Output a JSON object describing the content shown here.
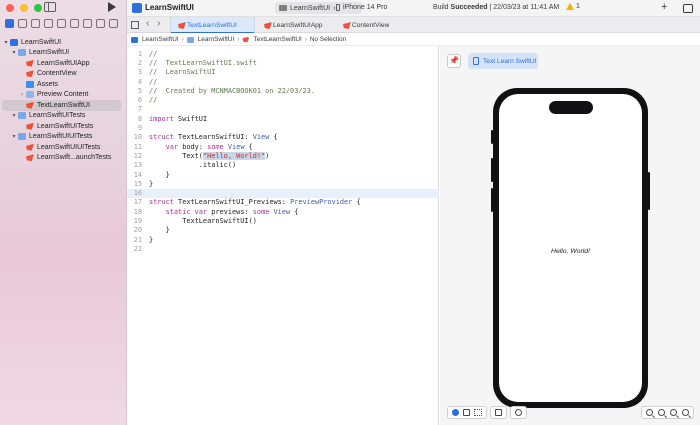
{
  "sidebar": {
    "tree": [
      {
        "label": "LearnSwiftUI",
        "kind": "project",
        "chevron": "▾",
        "indent": 0
      },
      {
        "label": "LearnSwiftUI",
        "kind": "folder",
        "chevron": "▾",
        "indent": 1
      },
      {
        "label": "LearnSwiftUIApp",
        "kind": "swift",
        "chevron": "",
        "indent": 2
      },
      {
        "label": "ContentView",
        "kind": "swift",
        "chevron": "",
        "indent": 2
      },
      {
        "label": "Assets",
        "kind": "assets",
        "chevron": "",
        "indent": 2
      },
      {
        "label": "Preview Content",
        "kind": "preview",
        "chevron": "›",
        "indent": 2
      },
      {
        "label": "TextLearnSwiftUI",
        "kind": "swift",
        "chevron": "",
        "indent": 2,
        "selected": true
      },
      {
        "label": "LearnSwiftUITests",
        "kind": "folder",
        "chevron": "▾",
        "indent": 1
      },
      {
        "label": "LearnSwiftUITests",
        "kind": "swift",
        "chevron": "",
        "indent": 2
      },
      {
        "label": "LearnSwiftUIUITests",
        "kind": "folder",
        "chevron": "▾",
        "indent": 1
      },
      {
        "label": "LearnSwiftUIUITests",
        "kind": "swift",
        "chevron": "",
        "indent": 2
      },
      {
        "label": "LearnSwift...aunchTests",
        "kind": "swift",
        "chevron": "",
        "indent": 2
      }
    ]
  },
  "toolbar": {
    "app_title": "LearnSwiftUI",
    "scheme": "LearnSwiftUI",
    "destination": "iPhone 14 Pro",
    "status_prefix": "Build",
    "status_bold": "Succeeded",
    "status_suffix": "| 22/03/23 at 11:41 AM",
    "warning_count": "1",
    "plus": "+"
  },
  "tabs": [
    {
      "label": "TextLearnSwiftUI",
      "active": true
    },
    {
      "label": "LearnSwiftUIApp",
      "active": false
    },
    {
      "label": "ContentView",
      "active": false
    }
  ],
  "nav": {
    "back": "‹",
    "forward": "›"
  },
  "breadcrumb": [
    "LearnSwiftUI",
    "LearnSwiftUI",
    "TextLearnSwiftUI",
    "No Selection"
  ],
  "code": {
    "current_line": 16,
    "lines": [
      [
        {
          "t": "//",
          "c": "comment"
        }
      ],
      [
        {
          "t": "//  TextLearnSwiftUI.swift",
          "c": "comment"
        }
      ],
      [
        {
          "t": "//  LearnSwiftUI",
          "c": "comment"
        }
      ],
      [
        {
          "t": "//",
          "c": "comment"
        }
      ],
      [
        {
          "t": "//  Created by MCNMACBOOK01 on 22/03/23.",
          "c": "comment"
        }
      ],
      [
        {
          "t": "//",
          "c": "comment"
        }
      ],
      [],
      [
        {
          "t": "import",
          "c": "kw"
        },
        {
          "t": " SwiftUI",
          "c": ""
        }
      ],
      [],
      [
        {
          "t": "struct",
          "c": "kw"
        },
        {
          "t": " TextLearnSwiftUI: ",
          "c": ""
        },
        {
          "t": "View",
          "c": "type"
        },
        {
          "t": " {",
          "c": ""
        }
      ],
      [
        {
          "t": "    ",
          "c": ""
        },
        {
          "t": "var",
          "c": "kw"
        },
        {
          "t": " body: ",
          "c": ""
        },
        {
          "t": "some",
          "c": "kw"
        },
        {
          "t": " ",
          "c": ""
        },
        {
          "t": "View",
          "c": "type"
        },
        {
          "t": " {",
          "c": ""
        }
      ],
      [
        {
          "t": "        Text(",
          "c": ""
        },
        {
          "t": "\"Hello, World!\"",
          "c": "str"
        },
        {
          "t": ")",
          "c": ""
        }
      ],
      [
        {
          "t": "            .italic()",
          "c": ""
        }
      ],
      [
        {
          "t": "    }",
          "c": ""
        }
      ],
      [
        {
          "t": "}",
          "c": ""
        }
      ],
      [],
      [
        {
          "t": "struct",
          "c": "kw"
        },
        {
          "t": " TextLearnSwiftUI_Previews: ",
          "c": ""
        },
        {
          "t": "PreviewProvider",
          "c": "type"
        },
        {
          "t": " {",
          "c": ""
        }
      ],
      [
        {
          "t": "    ",
          "c": ""
        },
        {
          "t": "static",
          "c": "kw"
        },
        {
          "t": " ",
          "c": ""
        },
        {
          "t": "var",
          "c": "kw"
        },
        {
          "t": " previews: ",
          "c": ""
        },
        {
          "t": "some",
          "c": "kw"
        },
        {
          "t": " ",
          "c": ""
        },
        {
          "t": "View",
          "c": "type"
        },
        {
          "t": " {",
          "c": ""
        }
      ],
      [
        {
          "t": "        TextLearnSwiftUI()",
          "c": ""
        }
      ],
      [
        {
          "t": "    }",
          "c": ""
        }
      ],
      [
        {
          "t": "}",
          "c": ""
        }
      ],
      []
    ]
  },
  "canvas": {
    "pin_glyph": "📌",
    "preview_chip_label": "Text Learn SwiftUI",
    "preview_text": "Hello, World!"
  },
  "colors": {
    "accent": "#2f6fe0",
    "swift_icon": "#f0513a",
    "keyword": "#a8329a",
    "type": "#3a5fa6",
    "string": "#c4302b",
    "comment": "#5f7d4e"
  },
  "icons": {
    "run": "play-icon",
    "sidebar_toggle": "sidebar-toggle-icon",
    "library": "library-icon",
    "warning": "warning-icon"
  }
}
